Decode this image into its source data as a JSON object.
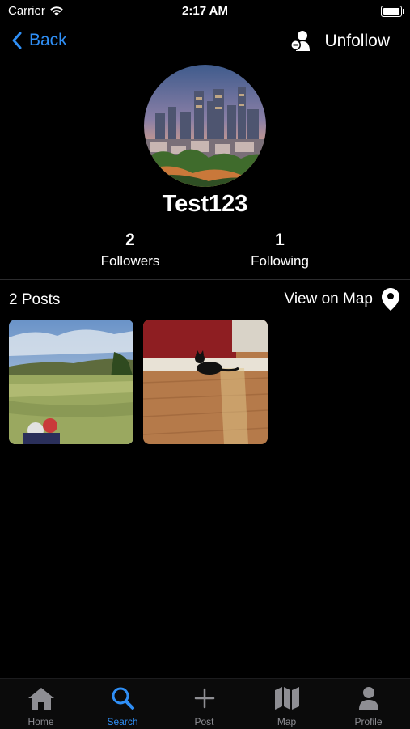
{
  "status_bar": {
    "carrier": "Carrier",
    "time": "2:17 AM"
  },
  "nav": {
    "back_label": "Back",
    "unfollow_label": "Unfollow"
  },
  "profile": {
    "username": "Test123",
    "followers_count": "2",
    "followers_label": "Followers",
    "following_count": "1",
    "following_label": "Following"
  },
  "posts": {
    "count_label": "2 Posts",
    "view_map_label": "View on Map",
    "items": [
      {
        "icon": "golf-course-photo"
      },
      {
        "icon": "black-cat-photo"
      }
    ]
  },
  "tabs": [
    {
      "label": "Home",
      "icon": "house-icon"
    },
    {
      "label": "Search",
      "icon": "magnifier-icon"
    },
    {
      "label": "Post",
      "icon": "plus-icon"
    },
    {
      "label": "Map",
      "icon": "map-icon"
    },
    {
      "label": "Profile",
      "icon": "person-icon"
    }
  ],
  "colors": {
    "accent": "#2f8ff6",
    "inactive_tab": "#8e8e93",
    "background": "#000000"
  }
}
